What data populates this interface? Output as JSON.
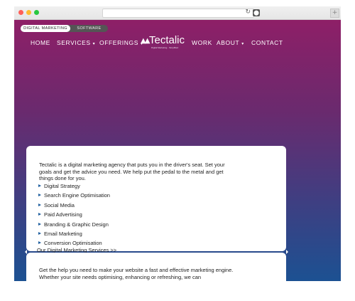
{
  "site_switch": {
    "active": "DIGITAL MARKETING",
    "other": "SOFTWARE"
  },
  "nav": {
    "home": "HOME",
    "services": "SERVICES",
    "offerings": "OFFERINGS",
    "work": "WORK",
    "about": "ABOUT",
    "contact": "CONTACT",
    "dropdown_caret": "▾"
  },
  "logo": {
    "name": "Tectalic",
    "tagline": "Digital Marketing · Simplified",
    "mark": "▲▲"
  },
  "browser": {
    "reload_icon": "↻",
    "extension_icon": "⬤",
    "new_tab_icon": "+"
  },
  "intro": "Tectalic is a digital marketing agency that puts you in the driver's seat. Set your goals and get the advice you need. We help put the pedal to the metal and get things done for you.",
  "services": [
    "Digital Strategy",
    "Search Engine Optimisation",
    "Social Media",
    "Paid Advertising",
    "Branding & Graphic Design",
    "Email Marketing",
    "Conversion Optimisation"
  ],
  "services_link": "Our Digital Marketing Services >>",
  "second_intro": "Get the help you need to make your website a fast and effective marketing engine. Whether your site needs optimising, enhancing or refreshing, we can"
}
